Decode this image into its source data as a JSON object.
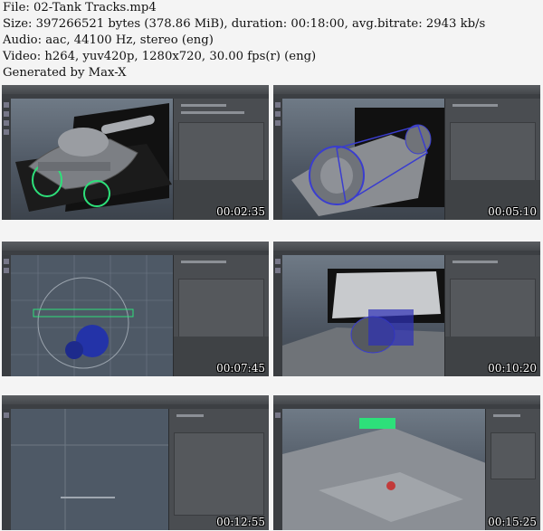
{
  "info": {
    "file": "File: 02-Tank Tracks.mp4",
    "size": "Size: 397266521 bytes (378.86 MiB), duration: 00:18:00, avg.bitrate: 2943 kb/s",
    "audio": "Audio: aac, 44100 Hz, stereo (eng)",
    "video": "Video: h264, yuv420p, 1280x720, 30.00 fps(r) (eng)",
    "generator": "Generated by Max-X"
  },
  "thumbnails": [
    {
      "timestamp": "00:02:35"
    },
    {
      "timestamp": "00:05:10"
    },
    {
      "timestamp": "00:07:45"
    },
    {
      "timestamp": "00:10:20"
    },
    {
      "timestamp": "00:12:55"
    },
    {
      "timestamp": "00:15:25"
    }
  ],
  "colors": {
    "background": "#f4f4f4",
    "viewport": "#5b6673",
    "panel": "#4a4d51",
    "selection": "#2de07a"
  }
}
